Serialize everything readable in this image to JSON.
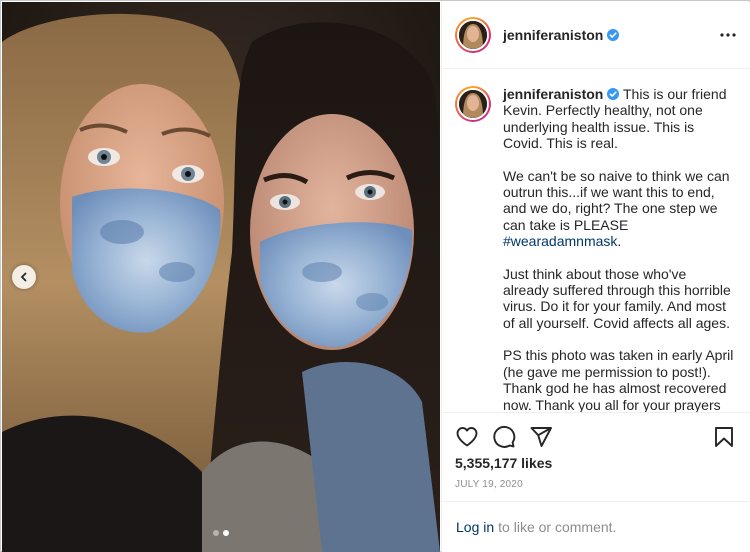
{
  "post": {
    "username": "jenniferaniston",
    "verified": true,
    "caption": {
      "username": "jenniferaniston",
      "p1": "This is our friend Kevin. Perfectly healthy, not one underlying health issue. This is Covid. This is real.",
      "p2_before": "We can't be so naive to think we can outrun this...if we want this to end, and we do, right? The one step we can take is PLEASE ",
      "p2_hashtag": "#wearadamnmask",
      "p2_after": ".",
      "p3": "Just think about those who've already suffered through this horrible virus. Do it for your family. And most of all yourself. Covid affects all ages.",
      "p4": "PS this photo was taken in early April (he gave me permission to post!). Thank god he has almost recovered now. Thank you all for your prayers 🙏🏼 ❤️"
    },
    "likes": "5,355,177 likes",
    "date": "JULY 19, 2020",
    "login_link": "Log in",
    "login_rest": "to like or comment.",
    "carousel": {
      "count": 2,
      "active": 2
    }
  },
  "icons": {
    "more": "more-options-icon",
    "like": "heart-icon",
    "comment": "comment-icon",
    "share": "paper-plane-icon",
    "save": "bookmark-icon",
    "prev": "chevron-left-icon",
    "verified": "verified-badge-icon"
  },
  "colors": {
    "verified": "#3897f0",
    "link": "#00376b",
    "muted": "#8e8e8e",
    "text": "#262626"
  }
}
